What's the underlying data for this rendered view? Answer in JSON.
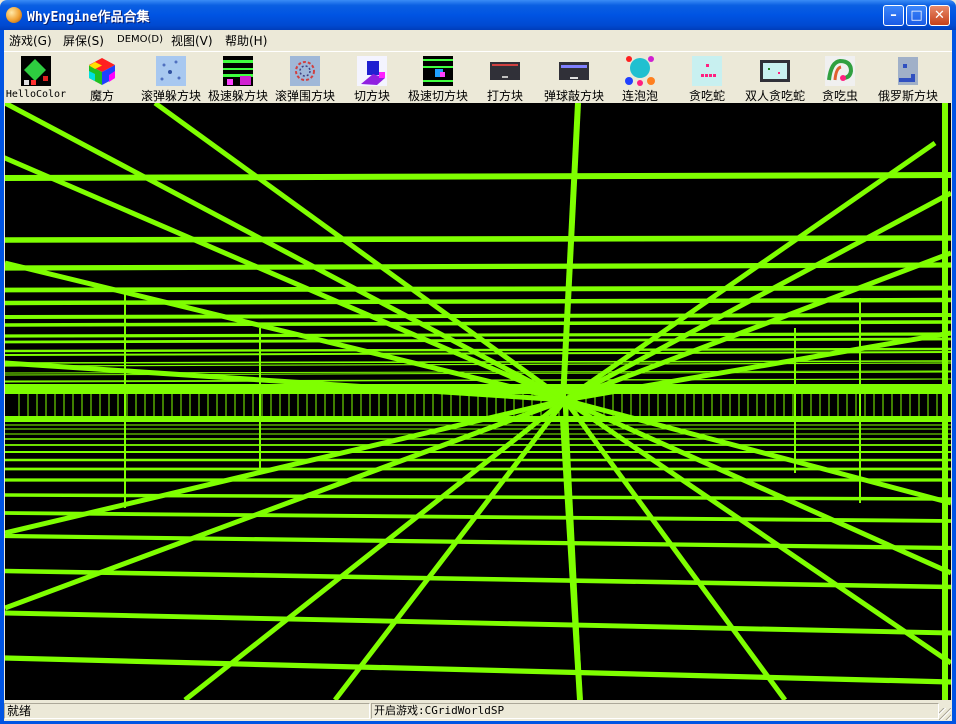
{
  "window": {
    "title": "WhyEngine作品合集",
    "icon": "app-orb-icon",
    "controls": [
      "minimize",
      "maximize",
      "close"
    ]
  },
  "menu": {
    "game": "游戏(G)",
    "screensaver": "屏保(S)",
    "demo": "DEMO(D)",
    "view": "视图(V)",
    "help": "帮助(H)"
  },
  "toolbar": [
    {
      "label": "HelloColor",
      "icon": "hellocolor-icon"
    },
    {
      "label": "魔方",
      "icon": "rubiks-cube-icon"
    },
    {
      "label": "滚弹躲方块",
      "icon": "rolling-ball-dodge-icon"
    },
    {
      "label": "极速躲方块",
      "icon": "speed-dodge-icon"
    },
    {
      "label": "滚弹围方块",
      "icon": "rolling-ball-enclose-icon"
    },
    {
      "label": "切方块",
      "icon": "cut-block-icon"
    },
    {
      "label": "极速切方块",
      "icon": "speed-cut-icon"
    },
    {
      "label": "打方块",
      "icon": "hit-block-icon"
    },
    {
      "label": "弹球敲方块",
      "icon": "pinball-block-icon"
    },
    {
      "label": "连泡泡",
      "icon": "bubble-link-icon"
    },
    {
      "label": "贪吃蛇",
      "icon": "snake-icon"
    },
    {
      "label": "双人贪吃蛇",
      "icon": "two-player-snake-icon"
    },
    {
      "label": "贪吃虫",
      "icon": "worm-icon"
    },
    {
      "label": "俄罗斯方块",
      "icon": "tetris-icon"
    }
  ],
  "scene": {
    "background": "#000000",
    "grid_color": "#7fff00"
  },
  "status": {
    "ready": "就绪",
    "game_started": "开启游戏:CGridWorldSP"
  }
}
